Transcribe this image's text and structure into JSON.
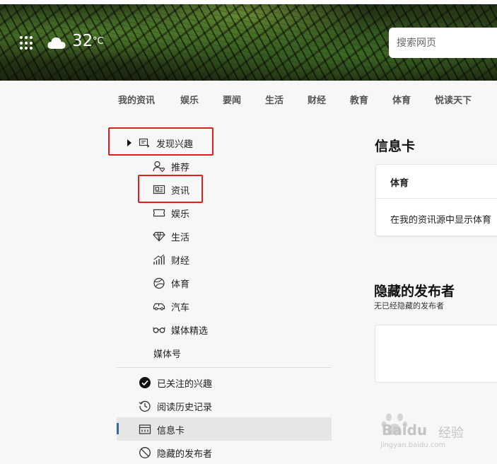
{
  "header": {
    "temperature": "32",
    "temperature_unit": "°C",
    "weather_icon": "cloud-icon",
    "apps_icon": "apps-grid-icon",
    "search_placeholder": "搜索网页"
  },
  "nav": {
    "tabs": [
      {
        "label": "我的资讯"
      },
      {
        "label": "娱乐"
      },
      {
        "label": "要闻"
      },
      {
        "label": "生活"
      },
      {
        "label": "财经"
      },
      {
        "label": "教育"
      },
      {
        "label": "体育"
      },
      {
        "label": "悦读天下"
      }
    ]
  },
  "menu": {
    "discover": {
      "label": "发现兴趣",
      "icon": "discover-interest-icon"
    },
    "items": [
      {
        "label": "推荐",
        "icon": "user-heart-icon"
      },
      {
        "label": "资讯",
        "icon": "newspaper-icon"
      },
      {
        "label": "娱乐",
        "icon": "ticket-icon"
      },
      {
        "label": "生活",
        "icon": "diamond-icon"
      },
      {
        "label": "财经",
        "icon": "bar-chart-icon"
      },
      {
        "label": "体育",
        "icon": "ball-icon"
      },
      {
        "label": "汽车",
        "icon": "car-icon"
      },
      {
        "label": "媒体精选",
        "icon": "glasses-icon"
      }
    ],
    "media": {
      "label": "媒体号"
    },
    "bottom": [
      {
        "label": "已关注的兴趣",
        "icon": "check-circle-icon"
      },
      {
        "label": "阅读历史记录",
        "icon": "history-icon"
      },
      {
        "label": "信息卡",
        "icon": "info-card-icon",
        "selected": true
      },
      {
        "label": "隐藏的发布者",
        "icon": "block-icon"
      }
    ],
    "accent_color": "#2b6cb8",
    "highlight_color": "#e0201a"
  },
  "info_card": {
    "title": "信息卡",
    "card_header": "体育",
    "card_body": "在我的资讯源中显示体育"
  },
  "hidden_publishers": {
    "title": "隐藏的发布者",
    "subtitle": "无已经隐藏的发布者"
  },
  "watermark": {
    "logo": "Baidu",
    "logo_suffix": "经验",
    "url": "jingyan.baidu.com"
  }
}
